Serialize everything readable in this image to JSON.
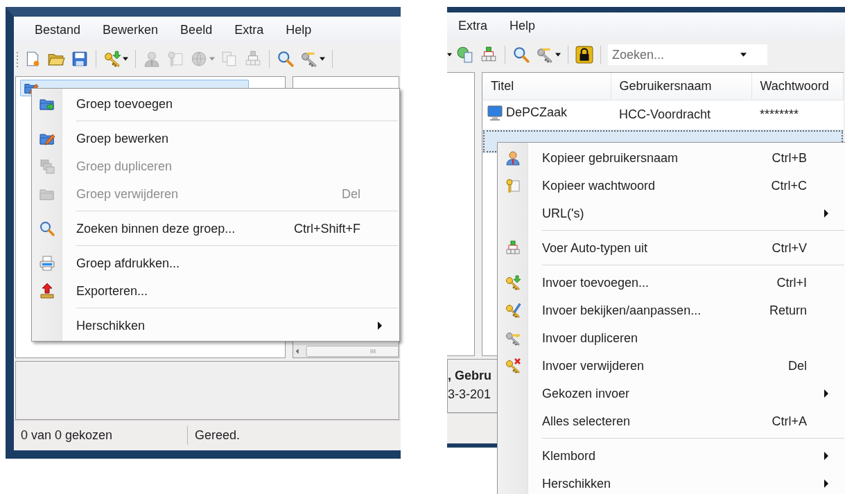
{
  "screens": [
    {
      "menu_bar": [
        "Bestand",
        "Bewerken",
        "Beeld",
        "Extra",
        "Help"
      ],
      "toolbar": [
        {
          "kind": "button",
          "disabled": false
        },
        {
          "kind": "button",
          "disabled": false
        },
        {
          "kind": "button",
          "disabled": false
        },
        {
          "kind": "separator"
        },
        {
          "kind": "button",
          "disabled": false,
          "dropdown": true
        },
        {
          "kind": "separator"
        },
        {
          "kind": "button",
          "disabled": true
        },
        {
          "kind": "button",
          "disabled": true
        },
        {
          "kind": "button",
          "disabled": true,
          "dropdown": true
        },
        {
          "kind": "button",
          "disabled": true
        },
        {
          "kind": "button",
          "disabled": true
        },
        {
          "kind": "separator"
        },
        {
          "kind": "button",
          "disabled": false
        },
        {
          "kind": "button",
          "disabled": false,
          "dropdown": true
        },
        {
          "kind": "separator"
        }
      ],
      "tree": [
        {
          "selected": true
        }
      ],
      "context_menu": [
        {
          "kind": "item",
          "label": "Groep toevoegen",
          "disabled": false
        },
        {
          "kind": "separator"
        },
        {
          "kind": "item",
          "label": "Groep bewerken",
          "disabled": false
        },
        {
          "kind": "item",
          "label": "Groep dupliceren",
          "disabled": true
        },
        {
          "kind": "item",
          "label": "Groep verwijderen",
          "shortcut": "Del",
          "disabled": true
        },
        {
          "kind": "separator"
        },
        {
          "kind": "item",
          "label": "Zoeken binnen deze groep...",
          "shortcut": "Ctrl+Shift+F",
          "disabled": false
        },
        {
          "kind": "separator"
        },
        {
          "kind": "item",
          "label": "Groep afdrukken...",
          "disabled": false
        },
        {
          "kind": "item",
          "label": "Exporteren...",
          "disabled": false
        },
        {
          "kind": "separator"
        },
        {
          "kind": "item",
          "label": "Herschikken",
          "disabled": false,
          "submenu": true
        }
      ],
      "status_bar": [
        "0 van 0 gekozen",
        "Gereed."
      ]
    },
    {
      "menu_bar": [
        "Extra",
        "Help"
      ],
      "toolbar": [
        {
          "kind": "caret"
        },
        {
          "kind": "button",
          "disabled": false
        },
        {
          "kind": "button",
          "disabled": false
        },
        {
          "kind": "separator"
        },
        {
          "kind": "button",
          "disabled": false
        },
        {
          "kind": "button",
          "disabled": false,
          "dropdown": true
        },
        {
          "kind": "separator"
        },
        {
          "kind": "button",
          "disabled": false
        },
        {
          "kind": "separator"
        }
      ],
      "search": {
        "placeholder": "Zoeken..."
      },
      "table": {
        "columns": [
          "Titel",
          "Gebruikersnaam",
          "Wachtwoord"
        ],
        "rows": [
          {
            "cells": [
              "DePCZaak",
              "HCC-Voordracht",
              "********"
            ],
            "selected": false
          },
          {
            "selected": true
          }
        ]
      },
      "details": [
        ", Gebru",
        "3-3-201"
      ],
      "context_menu": [
        {
          "kind": "item",
          "label": "Kopieer gebruikersnaam",
          "shortcut": "Ctrl+B",
          "disabled": false
        },
        {
          "kind": "item",
          "label": "Kopieer wachtwoord",
          "shortcut": "Ctrl+C",
          "disabled": false
        },
        {
          "kind": "item",
          "label": "URL('s)",
          "disabled": false,
          "submenu": true
        },
        {
          "kind": "separator"
        },
        {
          "kind": "item",
          "label": "Voer Auto-typen uit",
          "shortcut": "Ctrl+V",
          "disabled": false
        },
        {
          "kind": "separator"
        },
        {
          "kind": "item",
          "label": "Invoer toevoegen...",
          "shortcut": "Ctrl+I",
          "disabled": false
        },
        {
          "kind": "item",
          "label": "Invoer bekijken/aanpassen...",
          "shortcut": "Return",
          "disabled": false
        },
        {
          "kind": "item",
          "label": "Invoer dupliceren",
          "disabled": false
        },
        {
          "kind": "item",
          "label": "Invoer verwijderen",
          "shortcut": "Del",
          "disabled": false
        },
        {
          "kind": "item",
          "label": "Gekozen invoer",
          "disabled": false,
          "submenu": true
        },
        {
          "kind": "item",
          "label": "Alles selecteren",
          "shortcut": "Ctrl+A",
          "disabled": false
        },
        {
          "kind": "separator"
        },
        {
          "kind": "item",
          "label": "Klembord",
          "disabled": false,
          "submenu": true
        },
        {
          "kind": "item",
          "label": "Herschikken",
          "disabled": false,
          "submenu": true
        }
      ]
    }
  ]
}
